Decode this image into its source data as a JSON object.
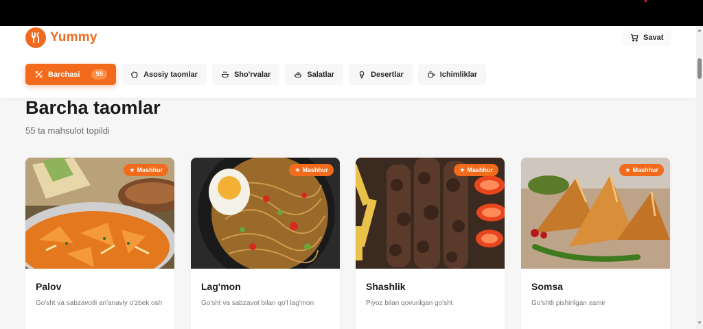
{
  "app": {
    "name": "Yummy"
  },
  "header": {
    "cart_label": "Savat"
  },
  "tabs": [
    {
      "label": "Barchasi",
      "count": "55",
      "icon": "utensils-crossed-icon",
      "active": true
    },
    {
      "label": "Asosiy taomlar",
      "icon": "chef-hat-icon"
    },
    {
      "label": "Sho'rvalar",
      "icon": "soup-icon"
    },
    {
      "label": "Salatlar",
      "icon": "salad-icon"
    },
    {
      "label": "Desertlar",
      "icon": "ice-cream-icon"
    },
    {
      "label": "Ichimliklar",
      "icon": "coffee-icon"
    }
  ],
  "main": {
    "title": "Barcha taomlar",
    "subtitle": "55 ta mahsulot topildi"
  },
  "products": [
    {
      "name": "Palov",
      "description": "Go'sht va sabzavotli an'anaviy o'zbek osh",
      "badge": "Mashhur"
    },
    {
      "name": "Lag'mon",
      "description": "Go'sht va sabzavot bilan qo'l lag'mon",
      "badge": "Mashhur"
    },
    {
      "name": "Shashlik",
      "description": "Piyoz bilan qovurilgan go'sht",
      "badge": "Mashhur"
    },
    {
      "name": "Somsa",
      "description": "Go'shtli pishirilgan xamir",
      "badge": "Mashhur"
    }
  ],
  "colors": {
    "accent": "#f26b1d",
    "topbar": "#000000",
    "background": "#f6f6f6"
  }
}
